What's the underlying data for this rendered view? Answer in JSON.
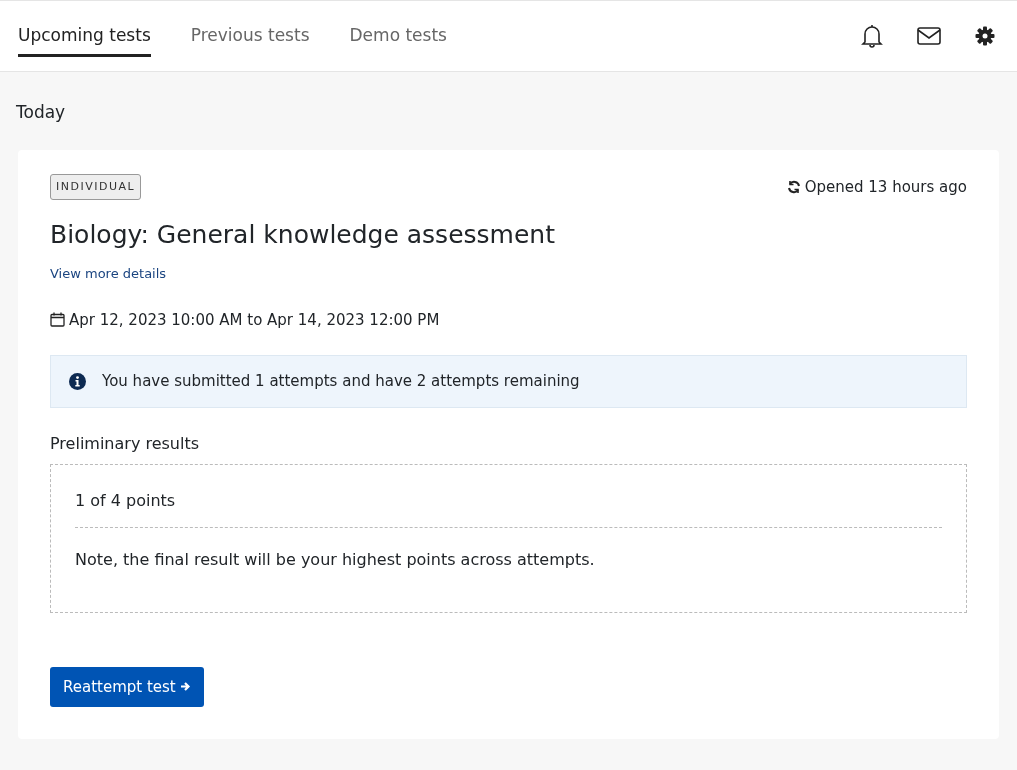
{
  "tabs": [
    {
      "label": "Upcoming tests",
      "selected": true
    },
    {
      "label": "Previous tests",
      "selected": false
    },
    {
      "label": "Demo tests",
      "selected": false
    }
  ],
  "section_heading": "Today",
  "test_card": {
    "badge": "INDIVIDUAL",
    "status": "Opened 13 hours ago",
    "title": "Biology: General knowledge assessment",
    "details_link": "View more details",
    "schedule": "Apr 12, 2023 10:00 AM to Apr 14, 2023 12:00 PM",
    "info_alert": "You have submitted 1 attempts and have 2 attempts remaining",
    "results_heading": "Preliminary results",
    "score": "1 of 4 points",
    "note": "Note, the final result will be your highest points across attempts.",
    "action_button": "Reattempt test"
  }
}
